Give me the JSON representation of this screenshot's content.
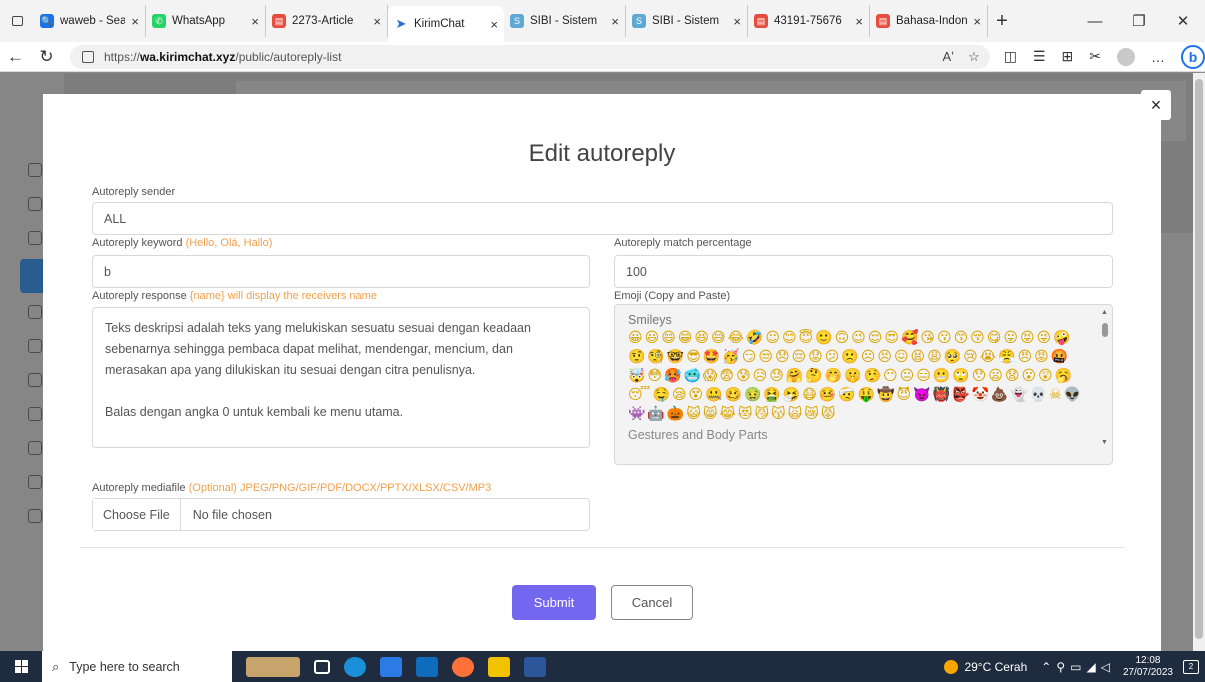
{
  "browser": {
    "tabs": [
      {
        "title": "waweb - Sear",
        "favicon_color": "#1a73e8"
      },
      {
        "title": "WhatsApp",
        "favicon_color": "#25d366"
      },
      {
        "title": "2273-Article",
        "favicon_color": "#e74c3c"
      },
      {
        "title": "KirimChat",
        "favicon_color": "#2e6bd6",
        "active": true
      },
      {
        "title": "SIBI - Sistem",
        "favicon_color": "#5fa8d3"
      },
      {
        "title": "SIBI - Sistem",
        "favicon_color": "#5fa8d3"
      },
      {
        "title": "43191-75676",
        "favicon_color": "#e74c3c"
      },
      {
        "title": "Bahasa-Indon",
        "favicon_color": "#e74c3c"
      }
    ],
    "url_prefix": "https://",
    "url_domain": "wa.kirimchat.xyz",
    "url_path": "/public/autoreply-list"
  },
  "modal": {
    "title": "Edit autoreply",
    "sender": {
      "label": "Autoreply sender",
      "value": "ALL"
    },
    "keyword": {
      "label": "Autoreply keyword",
      "hint": "(Hello, Olá, Hallo)",
      "value": "b"
    },
    "match": {
      "label": "Autoreply match percentage",
      "value": "100"
    },
    "response": {
      "label": "Autoreply response",
      "hint": "{name} will display the receivers name",
      "line1": "Teks deskripsi adalah teks yang melukiskan sesuatu sesuai dengan keadaan sebenarnya sehingga pembaca dapat melihat, mendengar, mencium, dan merasakan apa yang dilukiskan itu sesuai dengan citra penulisnya.",
      "line2": "",
      "line3": "Balas dengan angka 0 untuk kembali ke menu utama."
    },
    "emoji": {
      "label": "Emoji (Copy and Paste)",
      "category1": "Smileys",
      "glyphs": "😀😃😄😁😆😅😂🤣☺😊😇🙂🙃😉😌😍🥰😘😗😙😚😋😛😝😜🤪🤨🧐🤓😎🤩🥳😏😒😞😔😟😕🙁☹😣😖😫😩🥺😢😭😤😠😡🤬🤯😳🥵🥶😱😨😰😥😓🤗🤔🤭🤫🤥😶😐😑😬🙄😯😦😧😮😲🥱😴🤤😪😵🤐🥴🤢🤮🤧😷🤒🤕🤑🤠😈👿👹👺🤡💩👻💀☠👽👾🤖🎃😺😸😹😻😼😽🙀😿😾",
      "category2": "Gestures and Body Parts"
    },
    "media": {
      "label": "Autoreply mediafile",
      "hint": "(Optional) JPEG/PNG/GIF/PDF/DOCX/PPTX/XLSX/CSV/MP3",
      "button": "Choose File",
      "status": "No file chosen"
    },
    "submit": "Submit",
    "cancel": "Cancel",
    "close": "×"
  },
  "taskbar": {
    "search_placeholder": "Type here to search",
    "weather": "29°C  Cerah",
    "time": "12:08",
    "date": "27/07/2023",
    "notifications": "2"
  },
  "colors": {
    "accent": "#7367f0",
    "hint": "#f0a04b"
  }
}
